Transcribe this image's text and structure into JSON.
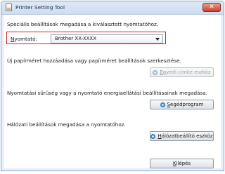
{
  "window": {
    "title": "Printer Setting Tool",
    "close_label": "✕"
  },
  "intro": {
    "text": "Speciális beállítások megadása a kiválasztott nyomtatóhoz."
  },
  "printer": {
    "label_hotkey": "N",
    "label_rest": "yomtató:",
    "selected": "Brother XX-XXXX"
  },
  "section_label": {
    "text": "Új papírméret hozzáadása vagy papírméret beállítások szerkesztése."
  },
  "label_tool_button": {
    "hotkey": "E",
    "rest": "gyedi címke eszköz",
    "enabled": false
  },
  "section_device": {
    "text": "Nyomtatási sűrűség vagy a nyomtató energiaellátási beállításainak megadása."
  },
  "utility_button": {
    "hotkey": "S",
    "rest": "egédprogram"
  },
  "section_network": {
    "text": "Hálózati beállítások megadása a nyomtatóhoz."
  },
  "network_button": {
    "hotkey": "H",
    "rest": "álózatbeállító eszköz"
  },
  "exit_button": {
    "hotkey": "K",
    "rest": "ilépés"
  }
}
